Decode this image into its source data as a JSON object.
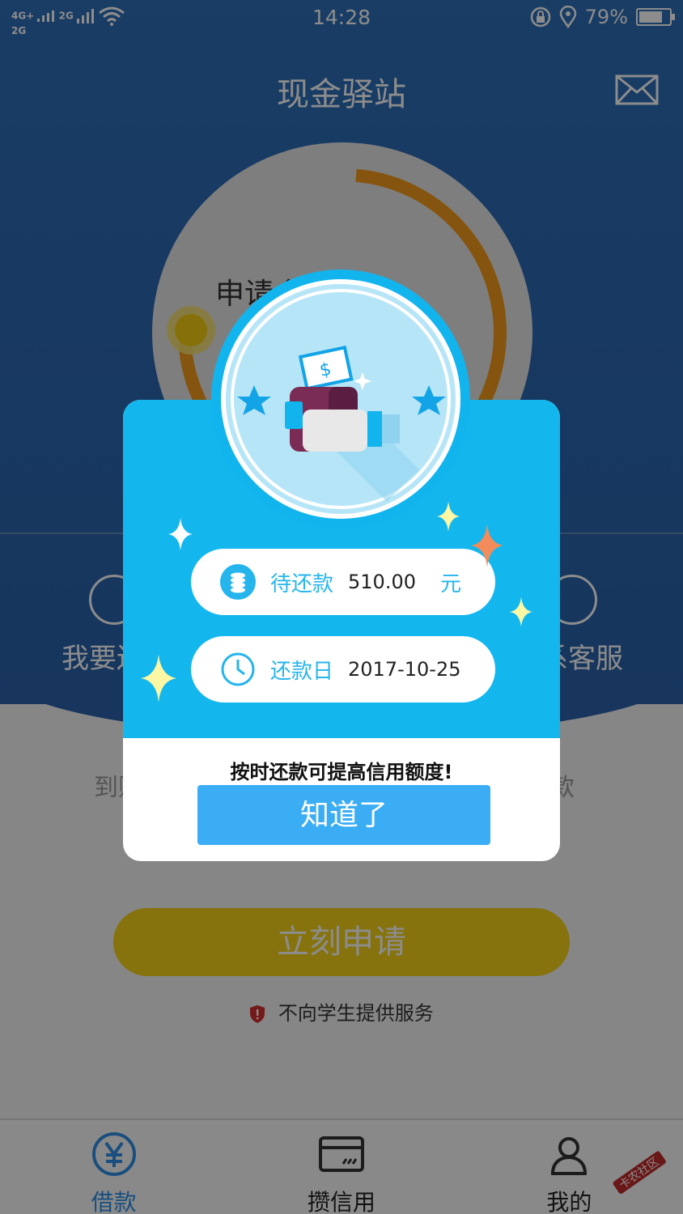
{
  "status_bar": {
    "network_top": "4G+",
    "network_bottom": "2G",
    "network_secondary": "2G",
    "time": "14:28",
    "battery_percent": "79%",
    "battery_level": 0.79,
    "icons": [
      "signal-icon",
      "wifi-icon",
      "lock-rotation-icon",
      "location-icon",
      "battery-icon"
    ]
  },
  "header": {
    "title": "现金驿站",
    "mail_icon": "mail-icon"
  },
  "dial": {
    "label": "申请金"
  },
  "features": {
    "left_label": "我要还",
    "right_label": "系客服"
  },
  "lower": {
    "left_text": "到账",
    "right_text": "款"
  },
  "apply_button": {
    "label": "立刻申请"
  },
  "notice": {
    "text": "不向学生提供服务"
  },
  "bottom_nav": {
    "items": [
      {
        "label": "借款",
        "icon": "yuan-icon",
        "active": true
      },
      {
        "label": "攒信用",
        "icon": "card-icon",
        "active": false
      },
      {
        "label": "我的",
        "icon": "user-icon",
        "active": false
      }
    ]
  },
  "dialog": {
    "repay_amount": {
      "label": "待还款",
      "value": "510.00",
      "unit": "元",
      "icon": "coins-icon"
    },
    "repay_date": {
      "label": "还款日",
      "value": "2017-10-25",
      "icon": "clock-icon"
    },
    "tip": "按时还款可提高信用额度!",
    "confirm_label": "知道了"
  },
  "colors": {
    "header_blue": "#2b66b0",
    "dialog_cyan": "#13b7ee",
    "button_blue": "#3badf5",
    "apply_yellow": "#f5d21a",
    "active_tab": "#2f8fe6"
  }
}
